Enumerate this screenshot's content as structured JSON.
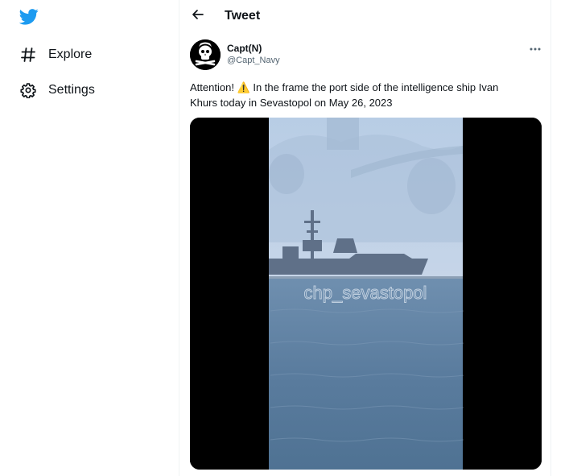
{
  "sidebar": {
    "logo_icon": "twitter-bird-icon",
    "items": [
      {
        "label": "Explore",
        "icon": "hashtag-icon"
      },
      {
        "label": "Settings",
        "icon": "gear-icon"
      }
    ]
  },
  "header": {
    "title": "Tweet",
    "back_icon": "arrow-left-icon"
  },
  "tweet": {
    "author_name": "Capt(N)",
    "author_handle": "@Capt_Navy",
    "text_line1_a": "Attention! ",
    "warning_emoji": "⚠️",
    "text_line1_b": " In the frame the port side of the intelligence ship Ivan",
    "text_line2": "Khurs today in Sevastopol on May 26, 2023",
    "media_watermark": "chp_sevastopol",
    "more_icon": "ellipsis-icon"
  },
  "colors": {
    "brand": "#1d9bf0",
    "text": "#0f1419",
    "secondary_text": "#536471",
    "border": "#eff3f4"
  }
}
